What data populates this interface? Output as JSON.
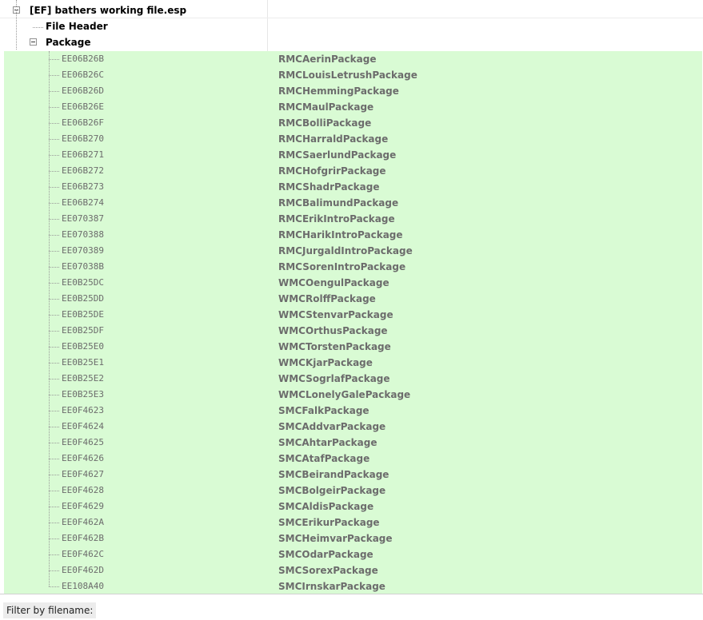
{
  "tree": {
    "file": "[EF] bathers working file.esp",
    "header": "File Header",
    "group": "Package",
    "records": [
      {
        "formid": "EE06B26B",
        "editor_id": "RMCAerinPackage"
      },
      {
        "formid": "EE06B26C",
        "editor_id": "RMCLouisLetrushPackage"
      },
      {
        "formid": "EE06B26D",
        "editor_id": "RMCHemmingPackage"
      },
      {
        "formid": "EE06B26E",
        "editor_id": "RMCMaulPackage"
      },
      {
        "formid": "EE06B26F",
        "editor_id": "RMCBolliPackage"
      },
      {
        "formid": "EE06B270",
        "editor_id": "RMCHarraldPackage"
      },
      {
        "formid": "EE06B271",
        "editor_id": "RMCSaerlundPackage"
      },
      {
        "formid": "EE06B272",
        "editor_id": "RMCHofgrirPackage"
      },
      {
        "formid": "EE06B273",
        "editor_id": "RMCShadrPackage"
      },
      {
        "formid": "EE06B274",
        "editor_id": "RMCBalimundPackage"
      },
      {
        "formid": "EE070387",
        "editor_id": "RMCErikIntroPackage"
      },
      {
        "formid": "EE070388",
        "editor_id": "RMCHarikIntroPackage"
      },
      {
        "formid": "EE070389",
        "editor_id": "RMCJurgaldIntroPackage"
      },
      {
        "formid": "EE07038B",
        "editor_id": "RMCSorenIntroPackage"
      },
      {
        "formid": "EE0B25DC",
        "editor_id": "WMCOengulPackage"
      },
      {
        "formid": "EE0B25DD",
        "editor_id": "WMCRolffPackage"
      },
      {
        "formid": "EE0B25DE",
        "editor_id": "WMCStenvarPackage"
      },
      {
        "formid": "EE0B25DF",
        "editor_id": "WMCOrthusPackage"
      },
      {
        "formid": "EE0B25E0",
        "editor_id": "WMCTorstenPackage"
      },
      {
        "formid": "EE0B25E1",
        "editor_id": "WMCKjarPackage"
      },
      {
        "formid": "EE0B25E2",
        "editor_id": "WMCSogrlafPackage"
      },
      {
        "formid": "EE0B25E3",
        "editor_id": "WMCLonelyGalePackage"
      },
      {
        "formid": "EE0F4623",
        "editor_id": "SMCFalkPackage"
      },
      {
        "formid": "EE0F4624",
        "editor_id": "SMCAddvarPackage"
      },
      {
        "formid": "EE0F4625",
        "editor_id": "SMCAhtarPackage"
      },
      {
        "formid": "EE0F4626",
        "editor_id": "SMCAtafPackage"
      },
      {
        "formid": "EE0F4627",
        "editor_id": "SMCBeirandPackage"
      },
      {
        "formid": "EE0F4628",
        "editor_id": "SMCBolgeirPackage"
      },
      {
        "formid": "EE0F4629",
        "editor_id": "SMCAldisPackage"
      },
      {
        "formid": "EE0F462A",
        "editor_id": "SMCErikurPackage"
      },
      {
        "formid": "EE0F462B",
        "editor_id": "SMCHeimvarPackage"
      },
      {
        "formid": "EE0F462C",
        "editor_id": "SMCOdarPackage"
      },
      {
        "formid": "EE0F462D",
        "editor_id": "SMCSorexPackage"
      },
      {
        "formid": "EE108A40",
        "editor_id": "SMCIrnskarPackage"
      }
    ]
  },
  "filter": {
    "label": "Filter by filename:",
    "value": ""
  },
  "colors": {
    "row_bg": "#d9fbd4",
    "record_text": "#6c6c6c"
  },
  "icons": {
    "expander": "minus-box-icon"
  }
}
